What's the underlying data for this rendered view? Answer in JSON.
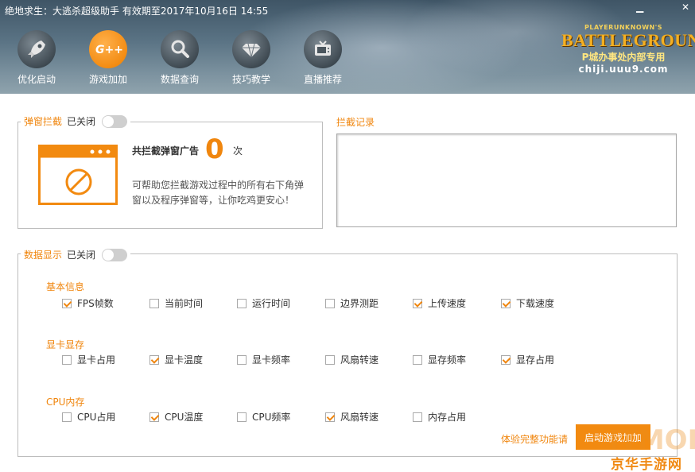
{
  "window": {
    "title": "绝地求生：大逃杀超级助手 有效期至2017年10月16日 14:55",
    "minimize": "▁",
    "close": "✕"
  },
  "nav": [
    {
      "label": "优化启动",
      "icon": "rocket-icon",
      "active": false
    },
    {
      "label": "游戏加加",
      "icon": "g-plus-icon",
      "active": true
    },
    {
      "label": "数据查询",
      "icon": "search-icon",
      "active": false
    },
    {
      "label": "技巧教学",
      "icon": "diamond-icon",
      "active": false
    },
    {
      "label": "直播推荐",
      "icon": "tv-icon",
      "active": false
    }
  ],
  "logo": {
    "top": "PLAYERUNKNOWN'S",
    "main": "BATTLEGROUNDS",
    "sub": "P城办事处内部专用",
    "url": "chiji.uuu9.com"
  },
  "popup_block": {
    "title": "弹窗拦截",
    "state": "已关闭",
    "count_prefix": "共拦截弹窗广告",
    "count": "0",
    "count_suffix": "次",
    "description": "可帮助您拦截游戏过程中的所有右下角弹窗以及程序弹窗等，让你吃鸡更安心！"
  },
  "record": {
    "title": "拦截记录"
  },
  "data_display": {
    "title": "数据显示",
    "state": "已关闭",
    "sections": [
      {
        "title": "基本信息",
        "items": [
          {
            "label": "FPS帧数",
            "checked": true
          },
          {
            "label": "当前时间",
            "checked": false
          },
          {
            "label": "运行时间",
            "checked": false
          },
          {
            "label": "边界测距",
            "checked": false
          },
          {
            "label": "上传速度",
            "checked": true
          },
          {
            "label": "下载速度",
            "checked": true
          }
        ]
      },
      {
        "title": "显卡显存",
        "items": [
          {
            "label": "显卡占用",
            "checked": false
          },
          {
            "label": "显卡温度",
            "checked": true
          },
          {
            "label": "显卡频率",
            "checked": false
          },
          {
            "label": "风扇转速",
            "checked": false
          },
          {
            "label": "显存频率",
            "checked": false
          },
          {
            "label": "显存占用",
            "checked": true
          }
        ]
      },
      {
        "title": "CPU内存",
        "items": [
          {
            "label": "CPU占用",
            "checked": false
          },
          {
            "label": "CPU温度",
            "checked": true
          },
          {
            "label": "CPU频率",
            "checked": false
          },
          {
            "label": "风扇转速",
            "checked": true
          },
          {
            "label": "内存占用",
            "checked": false
          }
        ]
      }
    ],
    "link": "体验完整功能请",
    "button": "启动游戏加加"
  },
  "watermark": {
    "main": "ITMOP",
    "sub": "京华手游网"
  },
  "colors": {
    "accent": "#f28a10",
    "label_orange": "#f0860e",
    "toggle_off": "#cfcfcf"
  }
}
